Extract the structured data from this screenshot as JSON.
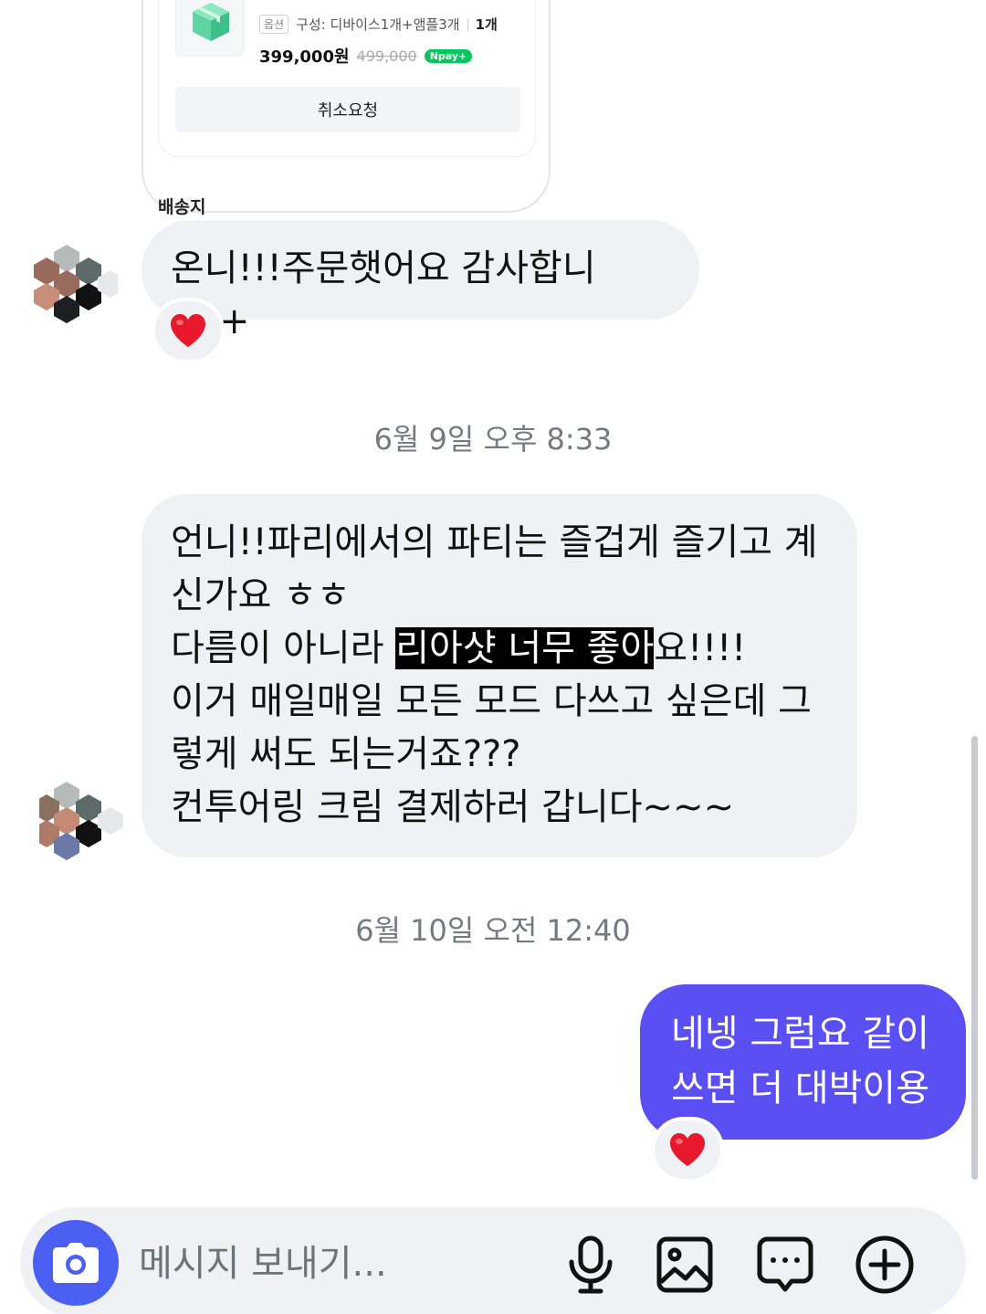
{
  "order_card": {
    "option_badge": "옵션",
    "option_text": "구성: 디바이스1개+앰플3개",
    "quantity": "1개",
    "price": "399,000원",
    "original_price": "499,000",
    "pay_badge": "Npay+",
    "cancel_label": "취소요청",
    "delivery_label": "배송지"
  },
  "messages": {
    "incoming_1": "온니!!!주문햇어요 감사합니다!+",
    "timestamp_1": "6월 9일 오후 8:33",
    "incoming_2": {
      "line1": "언니!!파리에서의 파티는 즐겁게 즐기고 계",
      "line2": "신가요 ㅎㅎ",
      "line3_before": "다름이 아니라 ",
      "line3_highlight": "리아샷 너무 좋아",
      "line3_after": "요!!!!",
      "line4": "이거 매일매일 모든 모드 다쓰고 싶은데 그",
      "line5": "렇게 써도 되는거죠???",
      "line6": "컨투어링 크림 결제하러 갑니다~~~"
    },
    "timestamp_2": "6월 10일 오전 12:40",
    "outgoing_1": {
      "line1": "네넹 그럼요 같이",
      "line2": "쓰면 더 대박이용"
    }
  },
  "reactions": {
    "reaction_1": "heart-icon",
    "reaction_2": "heart-icon"
  },
  "composer": {
    "placeholder": "메시지 보내기...",
    "icons": [
      "camera-icon",
      "microphone-icon",
      "image-icon",
      "sticker-icon",
      "plus-icon"
    ]
  },
  "colors": {
    "outgoing_bubble": "#5a4ff3",
    "incoming_bubble": "#eff1f4",
    "camera_button": "#4c5ff3",
    "heart": "#e8192c"
  }
}
